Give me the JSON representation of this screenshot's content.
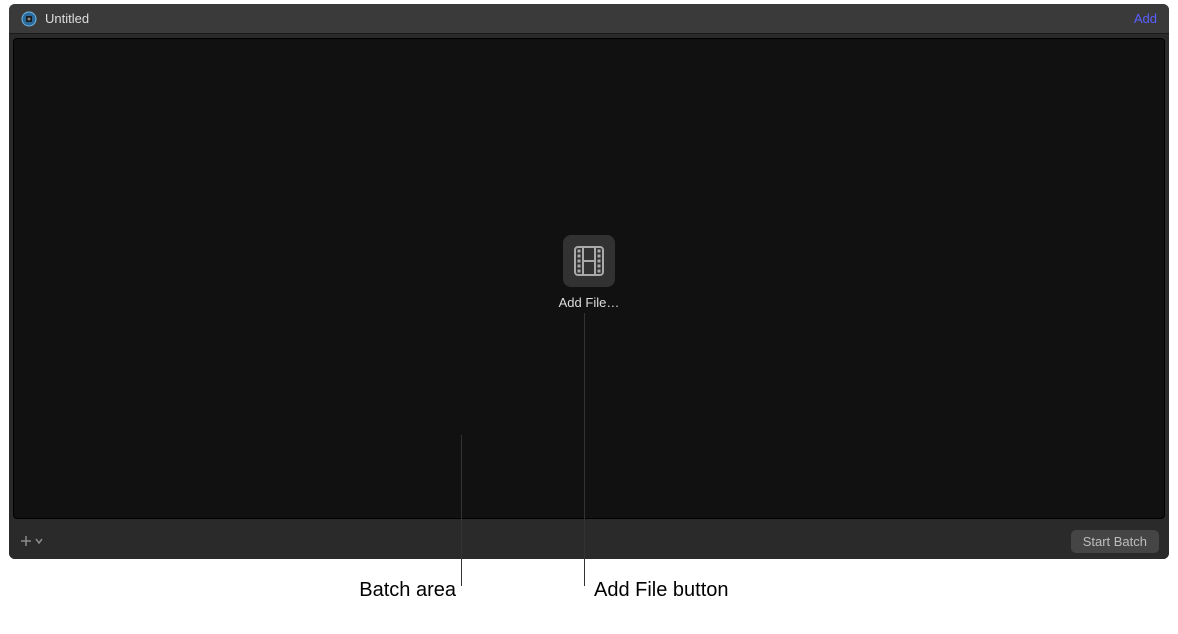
{
  "header": {
    "title": "Untitled",
    "add_label": "Add"
  },
  "batch": {
    "add_file_label": "Add File…"
  },
  "footer": {
    "start_batch_label": "Start Batch"
  },
  "callouts": {
    "batch_area_label": "Batch area",
    "add_file_button_label": "Add File button"
  }
}
